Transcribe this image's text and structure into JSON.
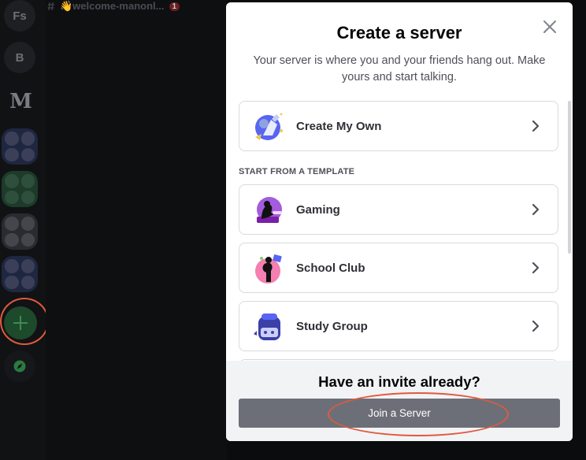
{
  "background": {
    "rail": {
      "server_fs": "Fs",
      "server_b": "B",
      "logo_text": "M"
    },
    "channel": {
      "name": "👋welcome-manonl...",
      "badge": "1"
    }
  },
  "modal": {
    "title": "Create a server",
    "subtitle": "Your server is where you and your friends hang out. Make yours and start talking.",
    "create_own": {
      "label": "Create My Own",
      "icon": "create-own-illustration"
    },
    "template_heading": "START FROM A TEMPLATE",
    "templates": [
      {
        "label": "Gaming",
        "icon": "gaming-illustration"
      },
      {
        "label": "School Club",
        "icon": "school-club-illustration"
      },
      {
        "label": "Study Group",
        "icon": "study-group-illustration"
      }
    ],
    "footer": {
      "title": "Have an invite already?",
      "join_label": "Join a Server"
    }
  },
  "colors": {
    "annotation": "#e05a3e",
    "join_button": "#6d6f78",
    "add_server": "#1d4a2b"
  }
}
